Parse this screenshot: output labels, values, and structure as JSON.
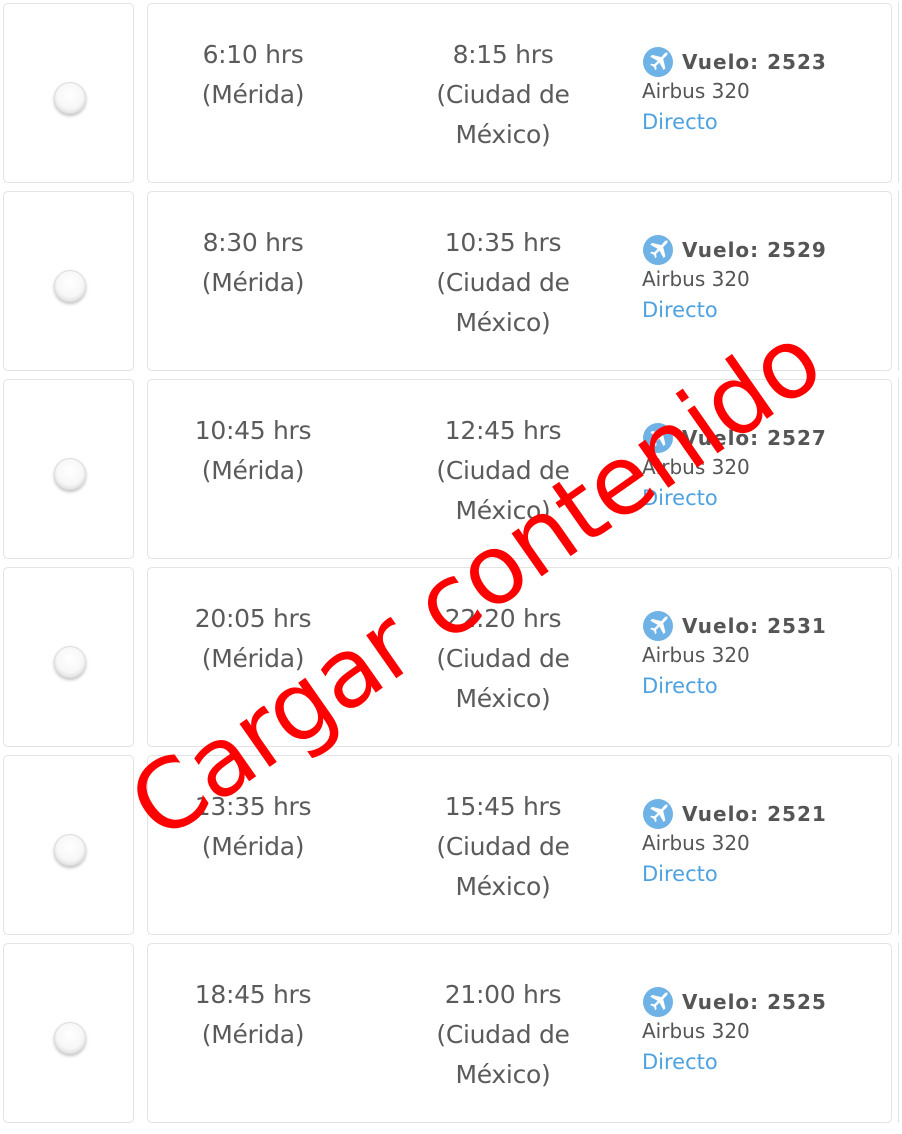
{
  "flights": [
    {
      "departure_time": "6:10 hrs",
      "departure_city": "(Mérida)",
      "arrival_time": "8:15 hrs",
      "arrival_city_line1": "(Ciudad de",
      "arrival_city_line2": "México)",
      "flight_label": "Vuelo: 2523",
      "aircraft": "Airbus 320",
      "route_type": "Directo"
    },
    {
      "departure_time": "8:30 hrs",
      "departure_city": "(Mérida)",
      "arrival_time": "10:35 hrs",
      "arrival_city_line1": "(Ciudad de",
      "arrival_city_line2": "México)",
      "flight_label": "Vuelo: 2529",
      "aircraft": "Airbus 320",
      "route_type": "Directo"
    },
    {
      "departure_time": "10:45 hrs",
      "departure_city": "(Mérida)",
      "arrival_time": "12:45 hrs",
      "arrival_city_line1": "(Ciudad de",
      "arrival_city_line2": "México)",
      "flight_label": "Vuelo: 2527",
      "aircraft": "Airbus 320",
      "route_type": "Directo"
    },
    {
      "departure_time": "20:05 hrs",
      "departure_city": "(Mérida)",
      "arrival_time": "22:20 hrs",
      "arrival_city_line1": "(Ciudad de",
      "arrival_city_line2": "México)",
      "flight_label": "Vuelo: 2531",
      "aircraft": "Airbus 320",
      "route_type": "Directo"
    },
    {
      "departure_time": "13:35 hrs",
      "departure_city": "(Mérida)",
      "arrival_time": "15:45 hrs",
      "arrival_city_line1": "(Ciudad de",
      "arrival_city_line2": "México)",
      "flight_label": "Vuelo: 2521",
      "aircraft": "Airbus 320",
      "route_type": "Directo"
    },
    {
      "departure_time": "18:45 hrs",
      "departure_city": "(Mérida)",
      "arrival_time": "21:00 hrs",
      "arrival_city_line1": "(Ciudad de",
      "arrival_city_line2": "México)",
      "flight_label": "Vuelo: 2525",
      "aircraft": "Airbus 320",
      "route_type": "Directo"
    }
  ],
  "icons": {
    "flight_icon": "airplane-icon",
    "icon_color": "#6eb2e6"
  },
  "colors": {
    "link": "#4fa2e0",
    "text": "#5b5b5b",
    "watermark": "#ff0000",
    "border": "#e3e3e3"
  },
  "watermark": {
    "text": "Cargar contenido"
  }
}
